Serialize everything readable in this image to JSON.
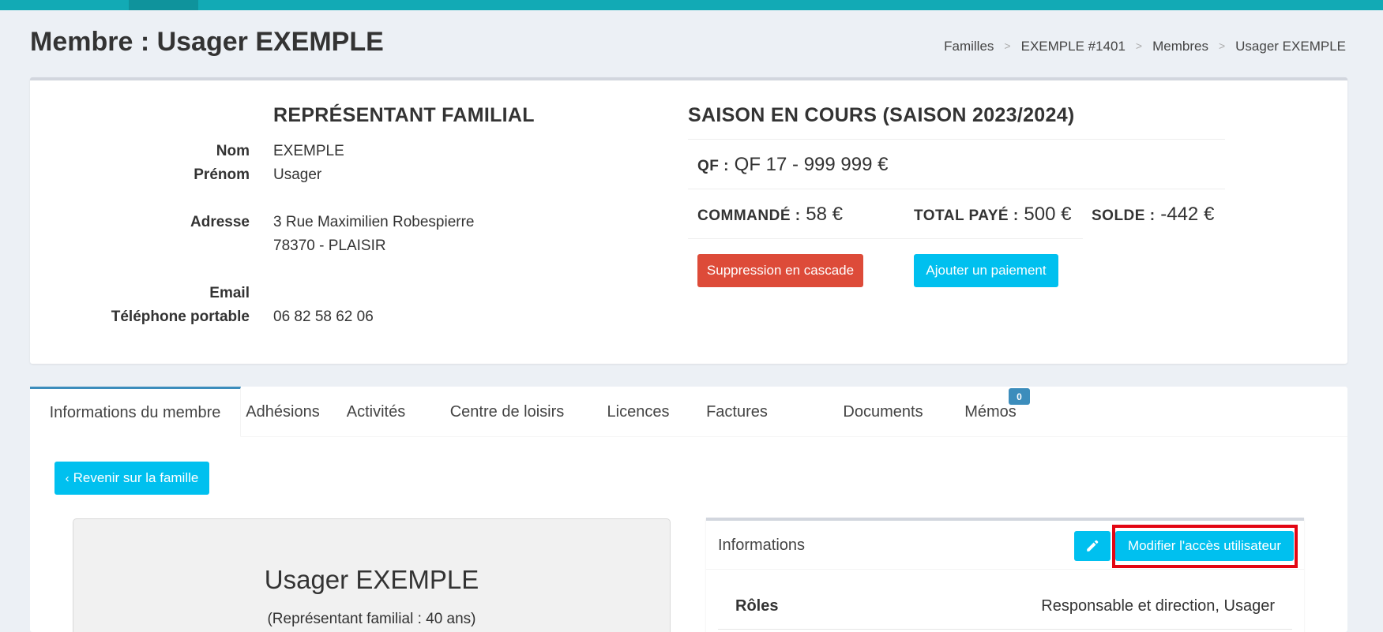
{
  "header": {
    "title": "Membre : Usager EXEMPLE",
    "breadcrumb": [
      "Familles",
      "EXEMPLE #1401",
      "Membres",
      "Usager EXEMPLE"
    ],
    "breadcrumb_sep": ">"
  },
  "representant": {
    "heading": "REPRÉSENTANT FAMILIAL",
    "nom_label": "Nom",
    "nom": "EXEMPLE",
    "prenom_label": "Prénom",
    "prenom": "Usager",
    "adresse_label": "Adresse",
    "adresse_line1": "3 Rue Maximilien Robespierre",
    "adresse_line2": "78370 - PLAISIR",
    "email_label": "Email",
    "email": "",
    "telephone_label": "Téléphone portable",
    "telephone": "06 82 58 62 06"
  },
  "saison": {
    "heading": "SAISON EN COURS (SAISON 2023/2024)",
    "qf_label": "QF :",
    "qf_value": "QF 17 - 999 999 €",
    "commande_label": "COMMANDÉ :",
    "commande_value": "58 €",
    "total_paye_label": "TOTAL PAYÉ :",
    "total_paye_value": "500 €",
    "solde_label": "SOLDE :",
    "solde_value": "-442 €",
    "btn_suppression": "Suppression en cascade",
    "btn_paiement": "Ajouter un paiement"
  },
  "tabs": [
    "Informations du membre",
    "Adhésions",
    "Activités",
    "Centre de loisirs",
    "Licences",
    "Factures",
    "Documents",
    "Mémos"
  ],
  "memos_badge": "0",
  "back_button": "Revenir sur la famille",
  "profile": {
    "name": "Usager EXEMPLE",
    "subtitle": "(Représentant familial : 40 ans)"
  },
  "informations": {
    "title": "Informations",
    "modify_access_button": "Modifier l'accès utilisateur",
    "roles_label": "Rôles",
    "roles_value": "Responsable et direction, Usager"
  },
  "colors": {
    "topbar": "#12aab5",
    "danger": "#dd4b39",
    "info": "#00c0ef",
    "primary": "#3c8dbc",
    "highlight": "#e30613"
  }
}
